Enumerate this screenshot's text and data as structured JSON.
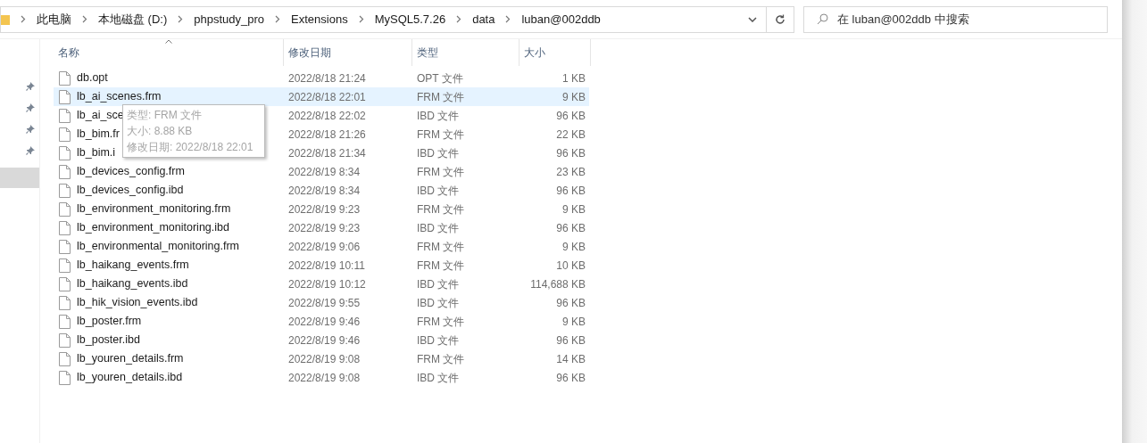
{
  "address_bar": {
    "crumbs": [
      "此电脑",
      "本地磁盘 (D:)",
      "phpstudy_pro",
      "Extensions",
      "MySQL5.7.26",
      "data",
      "luban@002ddb"
    ]
  },
  "search": {
    "placeholder": "在 luban@002ddb 中搜索"
  },
  "nav": {
    "items": [
      {
        "selected": true
      }
    ]
  },
  "columns": [
    {
      "label": "名称",
      "sorted": true
    },
    {
      "label": "修改日期",
      "sorted": false
    },
    {
      "label": "类型",
      "sorted": false
    },
    {
      "label": "大小",
      "sorted": false
    }
  ],
  "files": [
    {
      "name": "db.opt",
      "modified": "2022/8/18 21:24",
      "type": "OPT 文件",
      "size": "1 KB",
      "hovered": false
    },
    {
      "name": "lb_ai_scenes.frm",
      "modified": "2022/8/18 22:01",
      "type": "FRM 文件",
      "size": "9 KB",
      "hovered": true
    },
    {
      "name": "lb_ai_sce",
      "modified": "2022/8/18 22:02",
      "type": "IBD 文件",
      "size": "96 KB",
      "hovered": false
    },
    {
      "name": "lb_bim.fr",
      "modified": "2022/8/18 21:26",
      "type": "FRM 文件",
      "size": "22 KB",
      "hovered": false
    },
    {
      "name": "lb_bim.i",
      "modified": "2022/8/18 21:34",
      "type": "IBD 文件",
      "size": "96 KB",
      "hovered": false
    },
    {
      "name": "lb_devices_config.frm",
      "modified": "2022/8/19 8:34",
      "type": "FRM 文件",
      "size": "23 KB",
      "hovered": false
    },
    {
      "name": "lb_devices_config.ibd",
      "modified": "2022/8/19 8:34",
      "type": "IBD 文件",
      "size": "96 KB",
      "hovered": false
    },
    {
      "name": "lb_environment_monitoring.frm",
      "modified": "2022/8/19 9:23",
      "type": "FRM 文件",
      "size": "9 KB",
      "hovered": false
    },
    {
      "name": "lb_environment_monitoring.ibd",
      "modified": "2022/8/19 9:23",
      "type": "IBD 文件",
      "size": "96 KB",
      "hovered": false
    },
    {
      "name": "lb_environmental_monitoring.frm",
      "modified": "2022/8/19 9:06",
      "type": "FRM 文件",
      "size": "9 KB",
      "hovered": false
    },
    {
      "name": "lb_haikang_events.frm",
      "modified": "2022/8/19 10:11",
      "type": "FRM 文件",
      "size": "10 KB",
      "hovered": false
    },
    {
      "name": "lb_haikang_events.ibd",
      "modified": "2022/8/19 10:12",
      "type": "IBD 文件",
      "size": "114,688 KB",
      "hovered": false
    },
    {
      "name": "lb_hik_vision_events.ibd",
      "modified": "2022/8/19 9:55",
      "type": "IBD 文件",
      "size": "96 KB",
      "hovered": false
    },
    {
      "name": "lb_poster.frm",
      "modified": "2022/8/19 9:46",
      "type": "FRM 文件",
      "size": "9 KB",
      "hovered": false
    },
    {
      "name": "lb_poster.ibd",
      "modified": "2022/8/19 9:46",
      "type": "IBD 文件",
      "size": "96 KB",
      "hovered": false
    },
    {
      "name": "lb_youren_details.frm",
      "modified": "2022/8/19 9:08",
      "type": "FRM 文件",
      "size": "14 KB",
      "hovered": false
    },
    {
      "name": "lb_youren_details.ibd",
      "modified": "2022/8/19 9:08",
      "type": "IBD 文件",
      "size": "96 KB",
      "hovered": false
    }
  ],
  "tooltip": {
    "lines": [
      "类型: FRM 文件",
      "大小: 8.88 KB",
      "修改日期: 2022/8/18 22:01"
    ]
  }
}
